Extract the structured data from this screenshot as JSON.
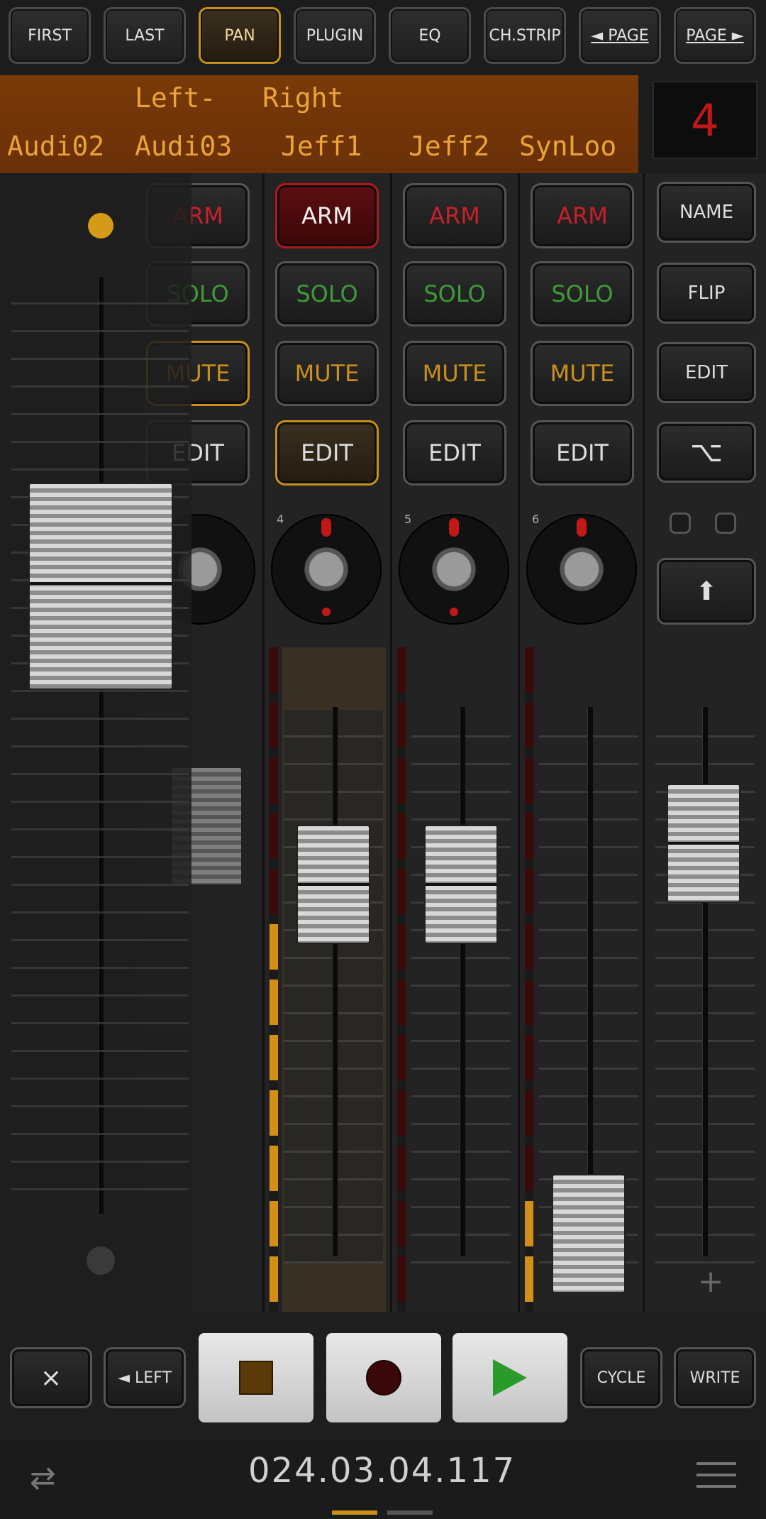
{
  "top_buttons": [
    {
      "label": "FIRST",
      "active": false
    },
    {
      "label": "LAST",
      "active": false
    },
    {
      "label": "PAN",
      "active": true
    },
    {
      "label": "PLUGIN",
      "active": false
    },
    {
      "label": "EQ",
      "active": false
    },
    {
      "label": "CH.STRIP",
      "active": false
    },
    {
      "label": "◄ PAGE",
      "active": false
    },
    {
      "label": "PAGE ►",
      "active": false
    }
  ],
  "names": {
    "row1": [
      "Left-",
      "Right"
    ],
    "row2": [
      "Audi02",
      "Audi03",
      "Jeff1",
      "Jeff2",
      "SynLoo"
    ]
  },
  "bank_number": "4",
  "channels": [
    {
      "number": "4",
      "arm": "ARM",
      "solo": "SOLO",
      "mute": "MUTE",
      "edit": "EDIT",
      "arm_active": true,
      "edit_active": true
    },
    {
      "number": "5",
      "arm": "ARM",
      "solo": "SOLO",
      "mute": "MUTE",
      "edit": "EDIT",
      "arm_active": false,
      "edit_active": false
    },
    {
      "number": "6",
      "arm": "ARM",
      "solo": "SOLO",
      "mute": "MUTE",
      "edit": "EDIT",
      "arm_active": false,
      "edit_active": false
    }
  ],
  "overlay_buttons": {
    "arm": "ARM",
    "solo": "SOLO",
    "mute": "MUTE",
    "edit": "EDIT"
  },
  "side_buttons": {
    "name": "NAME",
    "flip": "FLIP",
    "edit": "EDIT",
    "option_glyph": "⌥",
    "shift_glyph": "⬆"
  },
  "transport": {
    "rewind_glyph": "⨯",
    "left_label": "◄ LEFT",
    "cycle_label": "CYCLE",
    "write_label": "WRITE"
  },
  "timecode": "024.03.04.117",
  "icons": {
    "swap": "swap-icon",
    "menu": "menu-icon",
    "stop": "stop-icon",
    "record": "record-icon",
    "play": "play-icon"
  },
  "colors": {
    "accent": "#c8901a",
    "arm": "#c7202a",
    "solo": "#3f9a3a",
    "play": "#2a9a2a",
    "record": "#3a0808"
  }
}
